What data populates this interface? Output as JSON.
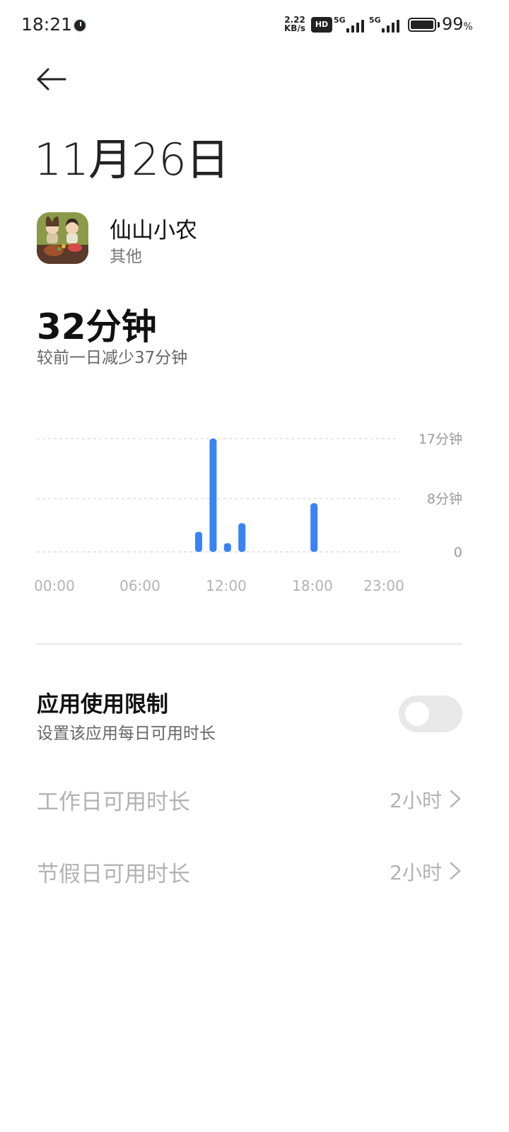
{
  "status_bar": {
    "time": "18:21",
    "net_speed_value": "2.22",
    "net_speed_unit": "KB/s",
    "hd_label": "HD",
    "signal_1_label": "5G",
    "signal_2_label": "5G",
    "battery_value": "99",
    "battery_unit": "%"
  },
  "header": {
    "date_title": "11月26日"
  },
  "app": {
    "name": "仙山小农",
    "category": "其他"
  },
  "usage": {
    "total": "32分钟",
    "comparison": "较前一日减少37分钟"
  },
  "chart_data": {
    "type": "bar",
    "x_tick_labels": [
      "00:00",
      "06:00",
      "12:00",
      "18:00",
      "23:00"
    ],
    "y_tick_labels": [
      "17分钟",
      "8分钟",
      "0"
    ],
    "ylim": [
      0,
      17
    ],
    "grid": true,
    "color": "#3a83f6",
    "series": [
      {
        "x_hours": [
          10,
          11,
          12,
          13,
          18
        ],
        "values": [
          3,
          17,
          1.3,
          4.3,
          7.3
        ]
      }
    ]
  },
  "limit": {
    "title": "应用使用限制",
    "subtitle": "设置该应用每日可用时长",
    "enabled": false
  },
  "settings": [
    {
      "label": "工作日可用时长",
      "value": "2小时"
    },
    {
      "label": "节假日可用时长",
      "value": "2小时"
    }
  ],
  "colors": {
    "accent": "#3a83f6",
    "disabled_text": "#b3b3b3",
    "toggle_off": "#e8e8e8"
  }
}
